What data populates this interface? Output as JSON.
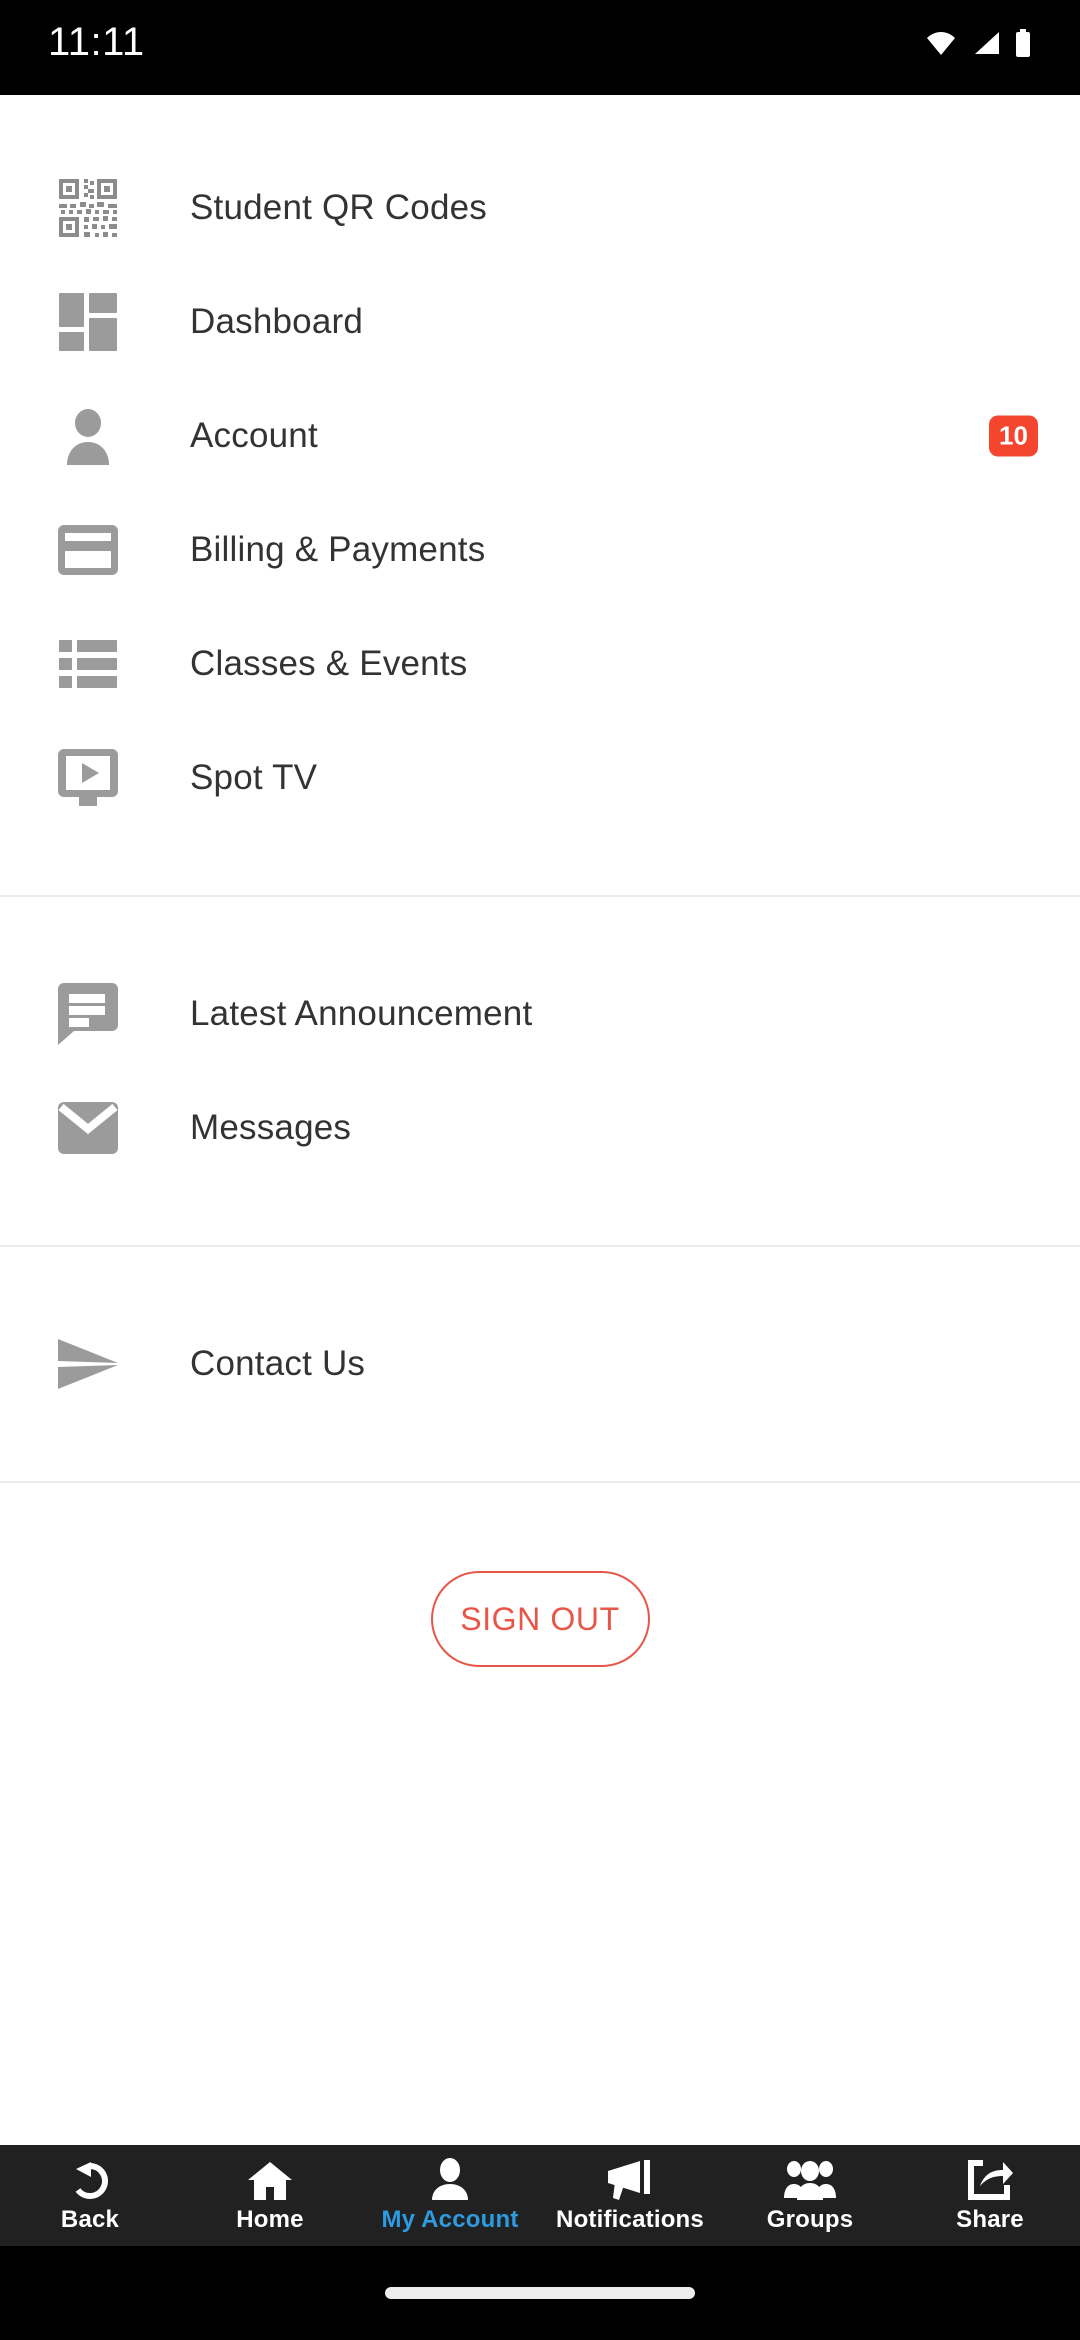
{
  "status_bar": {
    "time": "11:11",
    "icons": [
      "wifi-icon",
      "cellular-signal-icon",
      "battery-icon"
    ]
  },
  "menu": {
    "group_one": [
      {
        "label": "Student QR Codes",
        "icon": "qr-code-icon",
        "badge": null
      },
      {
        "label": "Dashboard",
        "icon": "dashboard-grid-icon",
        "badge": null
      },
      {
        "label": "Account",
        "icon": "person-icon",
        "badge": "10"
      },
      {
        "label": "Billing & Payments",
        "icon": "credit-card-icon",
        "badge": null
      },
      {
        "label": "Classes & Events",
        "icon": "list-icon",
        "badge": null
      },
      {
        "label": "Spot TV",
        "icon": "monitor-play-icon",
        "badge": null
      }
    ],
    "group_two": [
      {
        "label": "Latest Announcement",
        "icon": "speech-bubble-icon",
        "badge": null
      },
      {
        "label": "Messages",
        "icon": "envelope-icon",
        "badge": null
      }
    ],
    "group_three": [
      {
        "label": "Contact Us",
        "icon": "paper-plane-icon",
        "badge": null
      }
    ]
  },
  "sign_out": {
    "label": "SIGN OUT",
    "color": "#E8564A"
  },
  "bottom_nav": {
    "active_color": "#2E9BE0",
    "items": [
      {
        "label": "Back",
        "icon": "back-arrow-icon",
        "active": false
      },
      {
        "label": "Home",
        "icon": "home-icon",
        "active": false
      },
      {
        "label": "My Account",
        "icon": "person-icon",
        "active": true
      },
      {
        "label": "Notifications",
        "icon": "megaphone-icon",
        "active": false
      },
      {
        "label": "Groups",
        "icon": "people-group-icon",
        "active": false
      },
      {
        "label": "Share",
        "icon": "share-export-icon",
        "active": false
      }
    ]
  },
  "colors": {
    "badge_red": "#F4452F",
    "icon_gray": "#9B9B9B",
    "text_dark": "#333333",
    "divider": "#EBEBEB",
    "nav_background": "#212121"
  }
}
